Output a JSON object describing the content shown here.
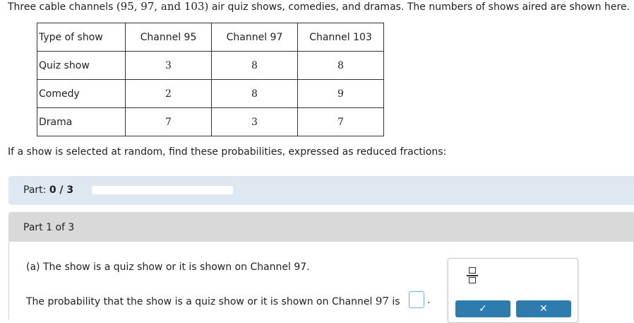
{
  "intro": {
    "before": "Three cable channels ",
    "channels": "(95, 97, and 103)",
    "after": " air quiz shows, comedies, and dramas. The numbers of shows aired are shown here."
  },
  "table": {
    "header": [
      "Type of show",
      "Channel 95",
      "Channel 97",
      "Channel 103"
    ],
    "rows": [
      [
        "Quiz show",
        "3",
        "8",
        "8"
      ],
      [
        "Comedy",
        "2",
        "8",
        "9"
      ],
      [
        "Drama",
        "7",
        "3",
        "7"
      ]
    ]
  },
  "question": "If a show is selected at random, find these probabilities, expressed as reduced fractions:",
  "part_status": {
    "label": "Part:",
    "value": "0 / 3",
    "progress_fraction": 0
  },
  "part_header": "Part 1 of 3",
  "part_a": "(a) The show is a quiz show or it is shown on Channel 97.",
  "answer": {
    "prefix": "The probability that the show is a quiz show or it is shown on Channel ",
    "channel": "97",
    "suffix": " is",
    "period": ".",
    "value": ""
  },
  "tools": {
    "fraction_icon": "fraction-icon",
    "check_icon": "check-icon",
    "clear_icon": "x-icon"
  },
  "colors": {
    "status_bg": "#dde8f0",
    "header_bg": "#d9d9d9",
    "button": "#2e7cad",
    "input_border": "#6fb0d8"
  }
}
